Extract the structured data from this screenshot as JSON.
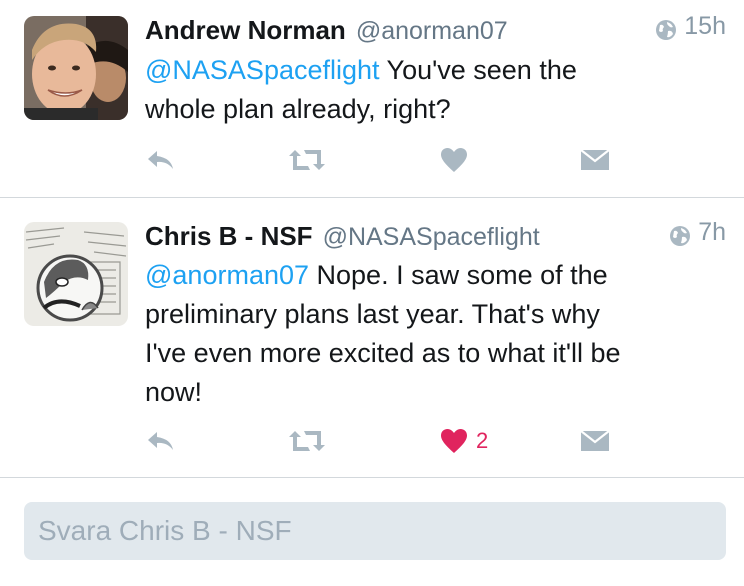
{
  "tweets": [
    {
      "name": "Andrew Norman",
      "handle": "@anorman07",
      "time": "15h",
      "mention": "@NASASpaceflight",
      "body_line1": " You've seen the",
      "body_line2": "whole plan already, right?",
      "liked": false,
      "like_count": ""
    },
    {
      "name": "Chris B - NSF",
      "handle": "@NASASpaceflight",
      "time": "7h",
      "mention": "@anorman07",
      "body_line1": " Nope. I saw some of the",
      "body_line2": "preliminary plans last year. That's why",
      "body_line3": "I've even more excited as to what it'll be",
      "body_line4": "now!",
      "liked": true,
      "like_count": "2"
    }
  ],
  "reply": {
    "placeholder": "Svara Chris B - NSF"
  },
  "icons": {
    "reply": "reply-arrow-icon",
    "retweet": "retweet-icon",
    "like": "heart-icon",
    "dm": "direct-message-icon",
    "globe": "globe-icon"
  },
  "colors": {
    "mention": "#1da1f2",
    "action_gray": "#aab8c2",
    "like_active": "#e0245e",
    "reply_bar": "#e1e8ed"
  }
}
